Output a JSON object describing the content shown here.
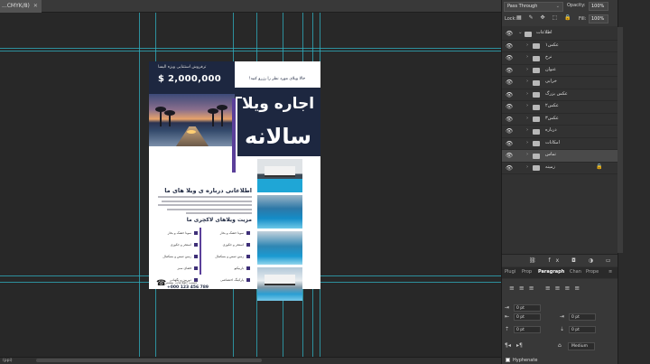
{
  "document_tab": {
    "title": "...CMYK/8)",
    "close": "✕"
  },
  "canvas": {
    "flyer": {
      "top_tagline": "ترفروش استثنایی ویژه الیسا",
      "price": "$ 2,000,000",
      "question": "خالا ویلای مورد نظر را رزرو کنید!",
      "title_line1": "اجاره ویلا",
      "title_line2": "سالانه",
      "about_title": "اطلاعاتی درباره ی ویلا های ما",
      "features_title": "مزیت ویلاهای لاکچری ما",
      "features_right": [
        "سونا خشک و بخار",
        "استخر و جکوزی",
        "زمین تنیس و بسکتبال",
        "باربیکیو",
        "پارکینگ اختصاصی"
      ],
      "features_left": [
        "سونا خشک و بخار",
        "استخر و جکوزی",
        "زمین تنیس و بسکتبال",
        "فضای سبز",
        "دوربین و نگهبانی"
      ],
      "contact_label": "کسب اطلاعات بیشتر",
      "contact_phone": "+000 123 456 789"
    }
  },
  "options_bar": {
    "blend_mode": "Pass Through",
    "opacity_label": "Opacity:",
    "opacity_value": "100%",
    "lock_label": "Lock:",
    "fill_label": "Fill:",
    "fill_value": "100%"
  },
  "layers": [
    {
      "name": "اطلاعات",
      "selected": false,
      "locked": false,
      "expanded": true
    },
    {
      "name": "عکس۱",
      "selected": false,
      "locked": false
    },
    {
      "name": "نرخ",
      "selected": false,
      "locked": false
    },
    {
      "name": "عنوان",
      "selected": false,
      "locked": false
    },
    {
      "name": "خرابی",
      "selected": false,
      "locked": false
    },
    {
      "name": "عکس بزرگ",
      "selected": false,
      "locked": false
    },
    {
      "name": "عکس۲",
      "selected": false,
      "locked": false
    },
    {
      "name": "عکس۳",
      "selected": false,
      "locked": false
    },
    {
      "name": "درباره",
      "selected": false,
      "locked": false
    },
    {
      "name": "امکانات",
      "selected": false,
      "locked": false
    },
    {
      "name": "تماس",
      "selected": true,
      "locked": false
    },
    {
      "name": "زمینه",
      "selected": false,
      "locked": true
    }
  ],
  "panel_tabs": [
    "Plugi",
    "Prop",
    "Paragraph",
    "Chan",
    "Prope"
  ],
  "active_panel_tab": "Paragraph",
  "paragraph": {
    "indent_left": "0 pt",
    "indent_right": "0 pt",
    "indent_first": "0 pt",
    "space_before": "0 pt",
    "space_after": "0 pt",
    "composer": "Medium",
    "hyphenate_label": "Hyphenate"
  },
  "status": {
    "zoom": "(ppi)"
  },
  "colors": {
    "navy": "#1d2740",
    "purple": "#5b3f9a",
    "guide": "#2fb3c4"
  }
}
